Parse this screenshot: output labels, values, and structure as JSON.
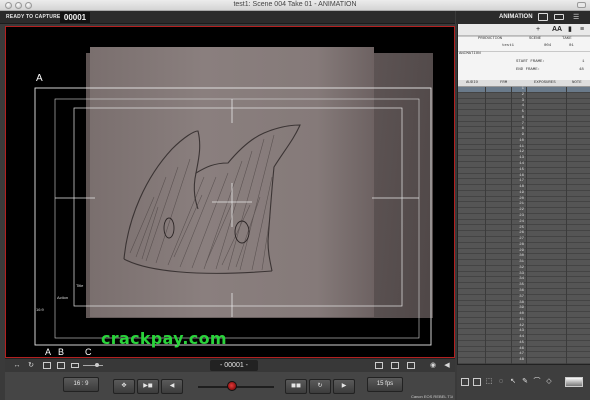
{
  "window": {
    "title": "test1: Scene 004  Take 01 - ANIMATION"
  },
  "capture": {
    "label": "READY TO CAPTURE:",
    "count": "00001"
  },
  "viewer": {
    "labels": {
      "a": "A"
    },
    "tiny_labels": {
      "title_safe": "Title",
      "action_safe": "Action",
      "ratio": "16:9"
    }
  },
  "watermark": "crackpay.com",
  "bottom": {
    "abc": {
      "a": "A",
      "b": "B",
      "c": "C"
    },
    "frame_number": "- 00001 -",
    "aspect": "16 : 9",
    "fps": "15 fps",
    "camera": "Canon EOS REBEL T1i"
  },
  "xsheet": {
    "title": "ANIMATION",
    "toolbar": {
      "font": "AA"
    },
    "info": {
      "production": "PRODUCTION",
      "scene": "SCENE",
      "take": "TAKE",
      "production_val": "test1",
      "scene_val": "004",
      "take_val": "01",
      "animation": "ANIMATION",
      "start_frame": "START FRAME:",
      "start_val": "1",
      "end_frame": "END FRAME:",
      "end_val": "48"
    },
    "columns": {
      "audio": "AUDIO",
      "frm": "FRM",
      "exposures": "EXPOSURES",
      "notes": "NOTE"
    },
    "rows": [
      "1",
      "2",
      "3",
      "4",
      "5",
      "6",
      "7",
      "8",
      "9",
      "10",
      "11",
      "12",
      "13",
      "14",
      "15",
      "16",
      "17",
      "18",
      "19",
      "20",
      "21",
      "22",
      "23",
      "24",
      "25",
      "26",
      "27",
      "28",
      "29",
      "30",
      "31",
      "32",
      "33",
      "34",
      "35",
      "36",
      "37",
      "38",
      "39",
      "40",
      "41",
      "42",
      "43",
      "44",
      "45",
      "46",
      "47",
      "48"
    ]
  },
  "colors": {
    "accent_red": "#b32020",
    "watermark_green": "#29d43a",
    "knob_red": "#e23a3a"
  }
}
